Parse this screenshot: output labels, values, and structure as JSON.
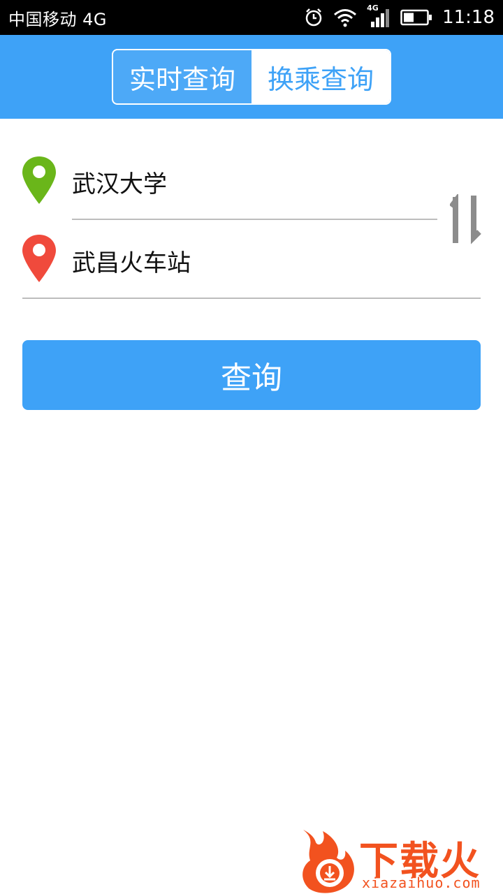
{
  "status_bar": {
    "carrier": "中国移动 4G",
    "network_badge": "4G",
    "time": "11:18",
    "icons": [
      "alarm-icon",
      "wifi-icon",
      "signal-icon",
      "battery-icon"
    ]
  },
  "header": {
    "tabs": [
      {
        "label": "实时查询",
        "active": false
      },
      {
        "label": "换乘查询",
        "active": true
      }
    ],
    "color": "#3ea2f7"
  },
  "route": {
    "origin": {
      "value": "武汉大学",
      "icon": "green-location-pin-icon",
      "color": "#6ab61a"
    },
    "destination": {
      "value": "武昌火车站",
      "icon": "red-location-pin-icon",
      "color": "#f04a3c"
    },
    "swap_icon": "swap-arrows-icon"
  },
  "actions": {
    "query_label": "查询"
  },
  "watermark": {
    "brand": "下载火",
    "site": "xiazaihuo.com",
    "color": "#f2521f"
  }
}
